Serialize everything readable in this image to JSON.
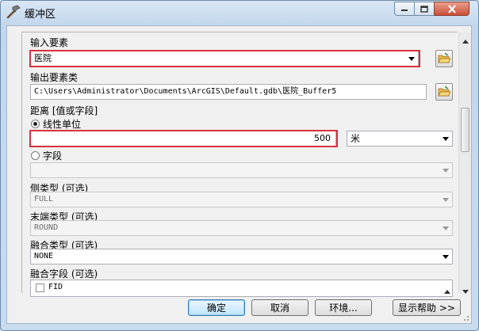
{
  "window": {
    "title": "缓冲区"
  },
  "form": {
    "input_features": {
      "label": "输入要素",
      "value": "医院"
    },
    "output_features": {
      "label": "输出要素类",
      "value": "C:\\Users\\Administrator\\Documents\\ArcGIS\\Default.gdb\\医院_Buffer5"
    },
    "distance": {
      "label": "距离 [值或字段]",
      "linear_unit_label": "线性单位",
      "linear_value": "500",
      "unit": "米",
      "field_label": "字段",
      "field_value": ""
    },
    "side_type": {
      "label": "侧类型 (可选)",
      "value": "FULL"
    },
    "end_type": {
      "label": "末端类型 (可选)",
      "value": "ROUND"
    },
    "dissolve_type": {
      "label": "融合类型 (可选)",
      "value": "NONE"
    },
    "dissolve_field": {
      "label": "融合字段 (可选)",
      "items": [
        "FID"
      ]
    }
  },
  "buttons": {
    "ok": "确定",
    "cancel": "取消",
    "environments": "环境...",
    "show_help": "显示帮助 >>"
  },
  "colors": {
    "highlight": "#d8323c",
    "title_bg": "#c3d7ec"
  }
}
